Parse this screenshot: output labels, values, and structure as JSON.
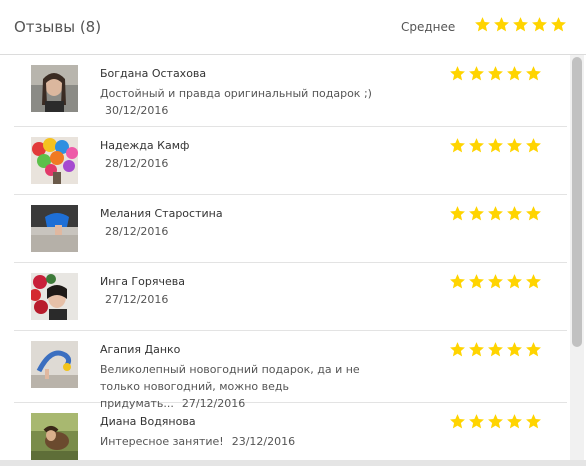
{
  "header": {
    "title": "Отзывы (8)",
    "average_label": "Среднее",
    "average_rating": 5,
    "star_color": "#FFD400"
  },
  "reviews": [
    {
      "name": "Богдана Остахова",
      "text": "Достойный и правда оригинальный подарок ;)",
      "date": "30/12/2016",
      "rating": 5,
      "avatar": "photo-avatar"
    },
    {
      "name": "Надежда Камф",
      "text": "",
      "date": "28/12/2016",
      "rating": 5,
      "avatar": "photo-avatar"
    },
    {
      "name": "Мелания Старостина",
      "text": "",
      "date": "28/12/2016",
      "rating": 5,
      "avatar": "photo-avatar"
    },
    {
      "name": "Инга Горячева",
      "text": "",
      "date": "27/12/2016",
      "rating": 5,
      "avatar": "photo-avatar"
    },
    {
      "name": "Агапия Данко",
      "text": "Великолепный новогодний подарок, да и не только новогодний, можно ведь придумать...",
      "date": "27/12/2016",
      "rating": 5,
      "avatar": "photo-avatar"
    },
    {
      "name": "Диана Водянова",
      "text": "Интересное занятие!",
      "date": "23/12/2016",
      "rating": 5,
      "avatar": "photo-avatar"
    }
  ]
}
